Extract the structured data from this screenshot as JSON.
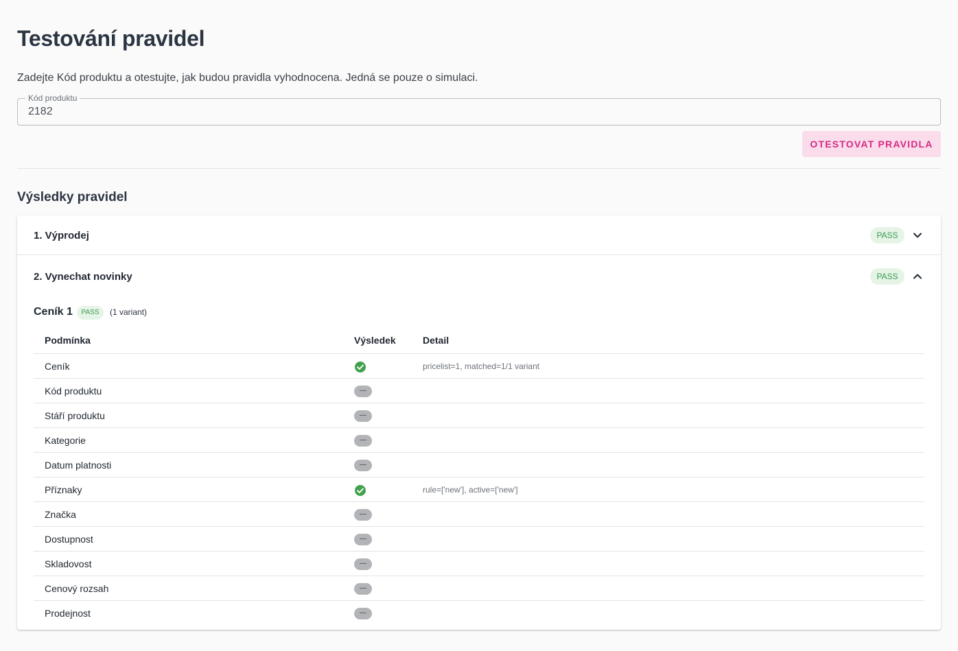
{
  "page": {
    "title": "Testování pravidel",
    "intro": "Zadejte Kód produktu a otestujte, jak budou pravidla vyhodnocena. Jedná se pouze o simulaci."
  },
  "form": {
    "product_code_label": "Kód produktu",
    "product_code_value": "2182",
    "test_button": "OTESTOVAT PRAVIDLA"
  },
  "results": {
    "title": "Výsledky pravidel",
    "rules": [
      {
        "label": "1. Výprodej",
        "status": "PASS",
        "expanded": false
      },
      {
        "label": "2. Vynechat novinky",
        "status": "PASS",
        "expanded": true
      }
    ],
    "pricelist": {
      "name": "Ceník 1",
      "status": "PASS",
      "count": "(1 variant)"
    },
    "table": {
      "headers": [
        "Podmínka",
        "Výsledek",
        "Detail"
      ],
      "rows": [
        {
          "condition": "Ceník",
          "result": "ok",
          "detail": "pricelist=1, matched=1/1 variant"
        },
        {
          "condition": "Kód produktu",
          "result": "—",
          "detail": ""
        },
        {
          "condition": "Stáří produktu",
          "result": "—",
          "detail": ""
        },
        {
          "condition": "Kategorie",
          "result": "—",
          "detail": ""
        },
        {
          "condition": "Datum platnosti",
          "result": "—",
          "detail": ""
        },
        {
          "condition": "Příznaky",
          "result": "ok",
          "detail": "rule=['new'], active=['new']"
        },
        {
          "condition": "Značka",
          "result": "—",
          "detail": ""
        },
        {
          "condition": "Dostupnost",
          "result": "—",
          "detail": ""
        },
        {
          "condition": "Skladovost",
          "result": "—",
          "detail": ""
        },
        {
          "condition": "Cenový rozsah",
          "result": "—",
          "detail": ""
        },
        {
          "condition": "Prodejnost",
          "result": "—",
          "detail": ""
        }
      ]
    }
  },
  "colors": {
    "accent": "#d22b86",
    "accent_bg": "#fbdcea",
    "pass": "#3a9a4d",
    "pass_bg": "#e6f4e8",
    "ok_icon": "#43a04d",
    "neutral_chip": "#b2b4b7"
  },
  "icons": {
    "collapsed": "chevron-down-icon",
    "expanded": "chevron-up-icon",
    "ok": "check-circle-icon",
    "skip": "dash-chip-icon"
  }
}
